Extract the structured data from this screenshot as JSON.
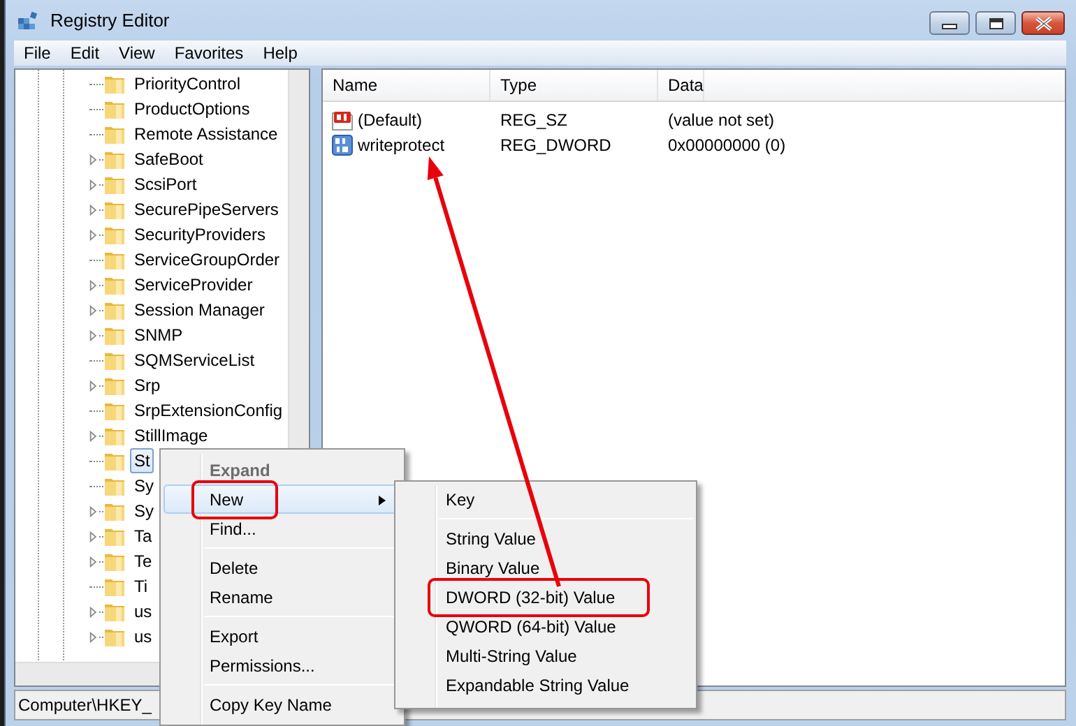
{
  "window": {
    "title": "Registry Editor"
  },
  "menu_bar": [
    "File",
    "Edit",
    "View",
    "Favorites",
    "Help"
  ],
  "tree": {
    "items": [
      {
        "label": "PriorityControl",
        "expandable": false,
        "selected": false
      },
      {
        "label": "ProductOptions",
        "expandable": false,
        "selected": false
      },
      {
        "label": "Remote Assistance",
        "expandable": false,
        "selected": false
      },
      {
        "label": "SafeBoot",
        "expandable": true,
        "selected": false
      },
      {
        "label": "ScsiPort",
        "expandable": true,
        "selected": false
      },
      {
        "label": "SecurePipeServers",
        "expandable": true,
        "selected": false
      },
      {
        "label": "SecurityProviders",
        "expandable": true,
        "selected": false
      },
      {
        "label": "ServiceGroupOrder",
        "expandable": false,
        "selected": false
      },
      {
        "label": "ServiceProvider",
        "expandable": true,
        "selected": false
      },
      {
        "label": "Session Manager",
        "expandable": true,
        "selected": false
      },
      {
        "label": "SNMP",
        "expandable": true,
        "selected": false
      },
      {
        "label": "SQMServiceList",
        "expandable": false,
        "selected": false
      },
      {
        "label": "Srp",
        "expandable": true,
        "selected": false
      },
      {
        "label": "SrpExtensionConfig",
        "expandable": false,
        "selected": false
      },
      {
        "label": "StillImage",
        "expandable": true,
        "selected": false
      },
      {
        "label": "St",
        "expandable": false,
        "selected": true
      },
      {
        "label": "Sy",
        "expandable": false,
        "selected": false
      },
      {
        "label": "Sy",
        "expandable": true,
        "selected": false
      },
      {
        "label": "Ta",
        "expandable": true,
        "selected": false
      },
      {
        "label": "Te",
        "expandable": true,
        "selected": false
      },
      {
        "label": "Ti",
        "expandable": false,
        "selected": false
      },
      {
        "label": "us",
        "expandable": true,
        "selected": false
      },
      {
        "label": "us",
        "expandable": true,
        "selected": false
      }
    ]
  },
  "values": {
    "columns": [
      "Name",
      "Type",
      "Data"
    ],
    "rows": [
      {
        "kind": "string",
        "name": "(Default)",
        "type": "REG_SZ",
        "data": "(value not set)",
        "arrow_target": false
      },
      {
        "kind": "binary",
        "name": "writeprotect",
        "type": "REG_DWORD",
        "data": "0x00000000 (0)",
        "arrow_target": true
      }
    ]
  },
  "status_bar": "Computer\\HKEY_",
  "context_menu": {
    "items": [
      {
        "kind": "item",
        "label": "Expand",
        "default": true,
        "disabled": true,
        "selected": false,
        "submenu": false,
        "boxed": false
      },
      {
        "kind": "item",
        "label": "New",
        "default": false,
        "disabled": false,
        "selected": true,
        "submenu": true,
        "boxed": true
      },
      {
        "kind": "item",
        "label": "Find...",
        "default": false,
        "disabled": false,
        "selected": false,
        "submenu": false,
        "boxed": false
      },
      {
        "kind": "separator"
      },
      {
        "kind": "item",
        "label": "Delete",
        "default": false,
        "disabled": false,
        "selected": false,
        "submenu": false,
        "boxed": false
      },
      {
        "kind": "item",
        "label": "Rename",
        "default": false,
        "disabled": false,
        "selected": false,
        "submenu": false,
        "boxed": false
      },
      {
        "kind": "separator"
      },
      {
        "kind": "item",
        "label": "Export",
        "default": false,
        "disabled": false,
        "selected": false,
        "submenu": false,
        "boxed": false
      },
      {
        "kind": "item",
        "label": "Permissions...",
        "default": false,
        "disabled": false,
        "selected": false,
        "submenu": false,
        "boxed": false
      },
      {
        "kind": "separator"
      },
      {
        "kind": "item",
        "label": "Copy Key Name",
        "default": false,
        "disabled": false,
        "selected": false,
        "submenu": false,
        "boxed": false
      }
    ]
  },
  "submenu": {
    "items": [
      {
        "kind": "item",
        "label": "Key",
        "boxed": false,
        "arrow_from": false
      },
      {
        "kind": "separator"
      },
      {
        "kind": "item",
        "label": "String Value",
        "boxed": false,
        "arrow_from": false
      },
      {
        "kind": "item",
        "label": "Binary Value",
        "boxed": false,
        "arrow_from": false
      },
      {
        "kind": "item",
        "label": "DWORD (32-bit) Value",
        "boxed": true,
        "arrow_from": true
      },
      {
        "kind": "item",
        "label": "QWORD (64-bit) Value",
        "boxed": false,
        "arrow_from": false
      },
      {
        "kind": "item",
        "label": "Multi-String Value",
        "boxed": false,
        "arrow_from": false
      },
      {
        "kind": "item",
        "label": "Expandable String Value",
        "boxed": false,
        "arrow_from": false
      }
    ]
  }
}
